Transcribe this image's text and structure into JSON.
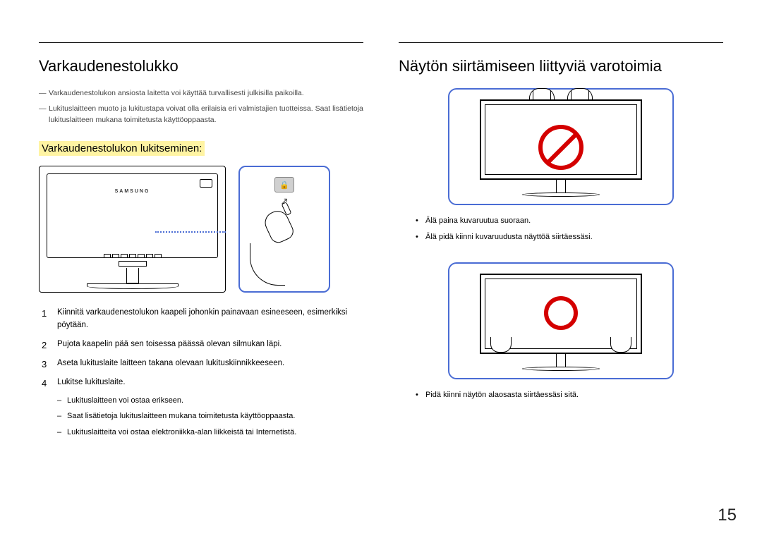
{
  "left": {
    "title": "Varkaudenestolukko",
    "notes": [
      "Varkaudenestolukon ansiosta laitetta voi käyttää turvallisesti julkisilla paikoilla.",
      "Lukituslaitteen muoto ja lukitustapa voivat olla erilaisia eri valmistajien tuotteissa. Saat lisätietoja lukituslaitteen mukana toimitetusta käyttöoppaasta."
    ],
    "subheading": "Varkaudenestolukon lukitseminen:",
    "brand": "SAMSUNG",
    "lock_icon": "🔒",
    "steps": [
      "Kiinnitä varkaudenestolukon kaapeli johonkin painavaan esineeseen, esimerkiksi pöytään.",
      "Pujota kaapelin pää sen toisessa päässä olevan silmukan läpi.",
      "Aseta lukituslaite laitteen takana olevaan lukituskiinnikkeeseen.",
      "Lukitse lukituslaite."
    ],
    "substeps": [
      "Lukituslaitteen voi ostaa erikseen.",
      "Saat lisätietoja lukituslaitteen mukana toimitetusta käyttöoppaasta.",
      "Lukituslaitteita voi ostaa elektroniikka-alan liikkeistä tai Internetistä."
    ]
  },
  "right": {
    "title": "Näytön siirtämiseen liittyviä varotoimia",
    "bullets1": [
      "Älä paina kuvaruutua suoraan.",
      "Älä pidä kiinni kuvaruudusta näyttöä siirtäessäsi."
    ],
    "bullets2": [
      "Pidä kiinni näytön alaosasta siirtäessäsi sitä."
    ]
  },
  "page": "15"
}
